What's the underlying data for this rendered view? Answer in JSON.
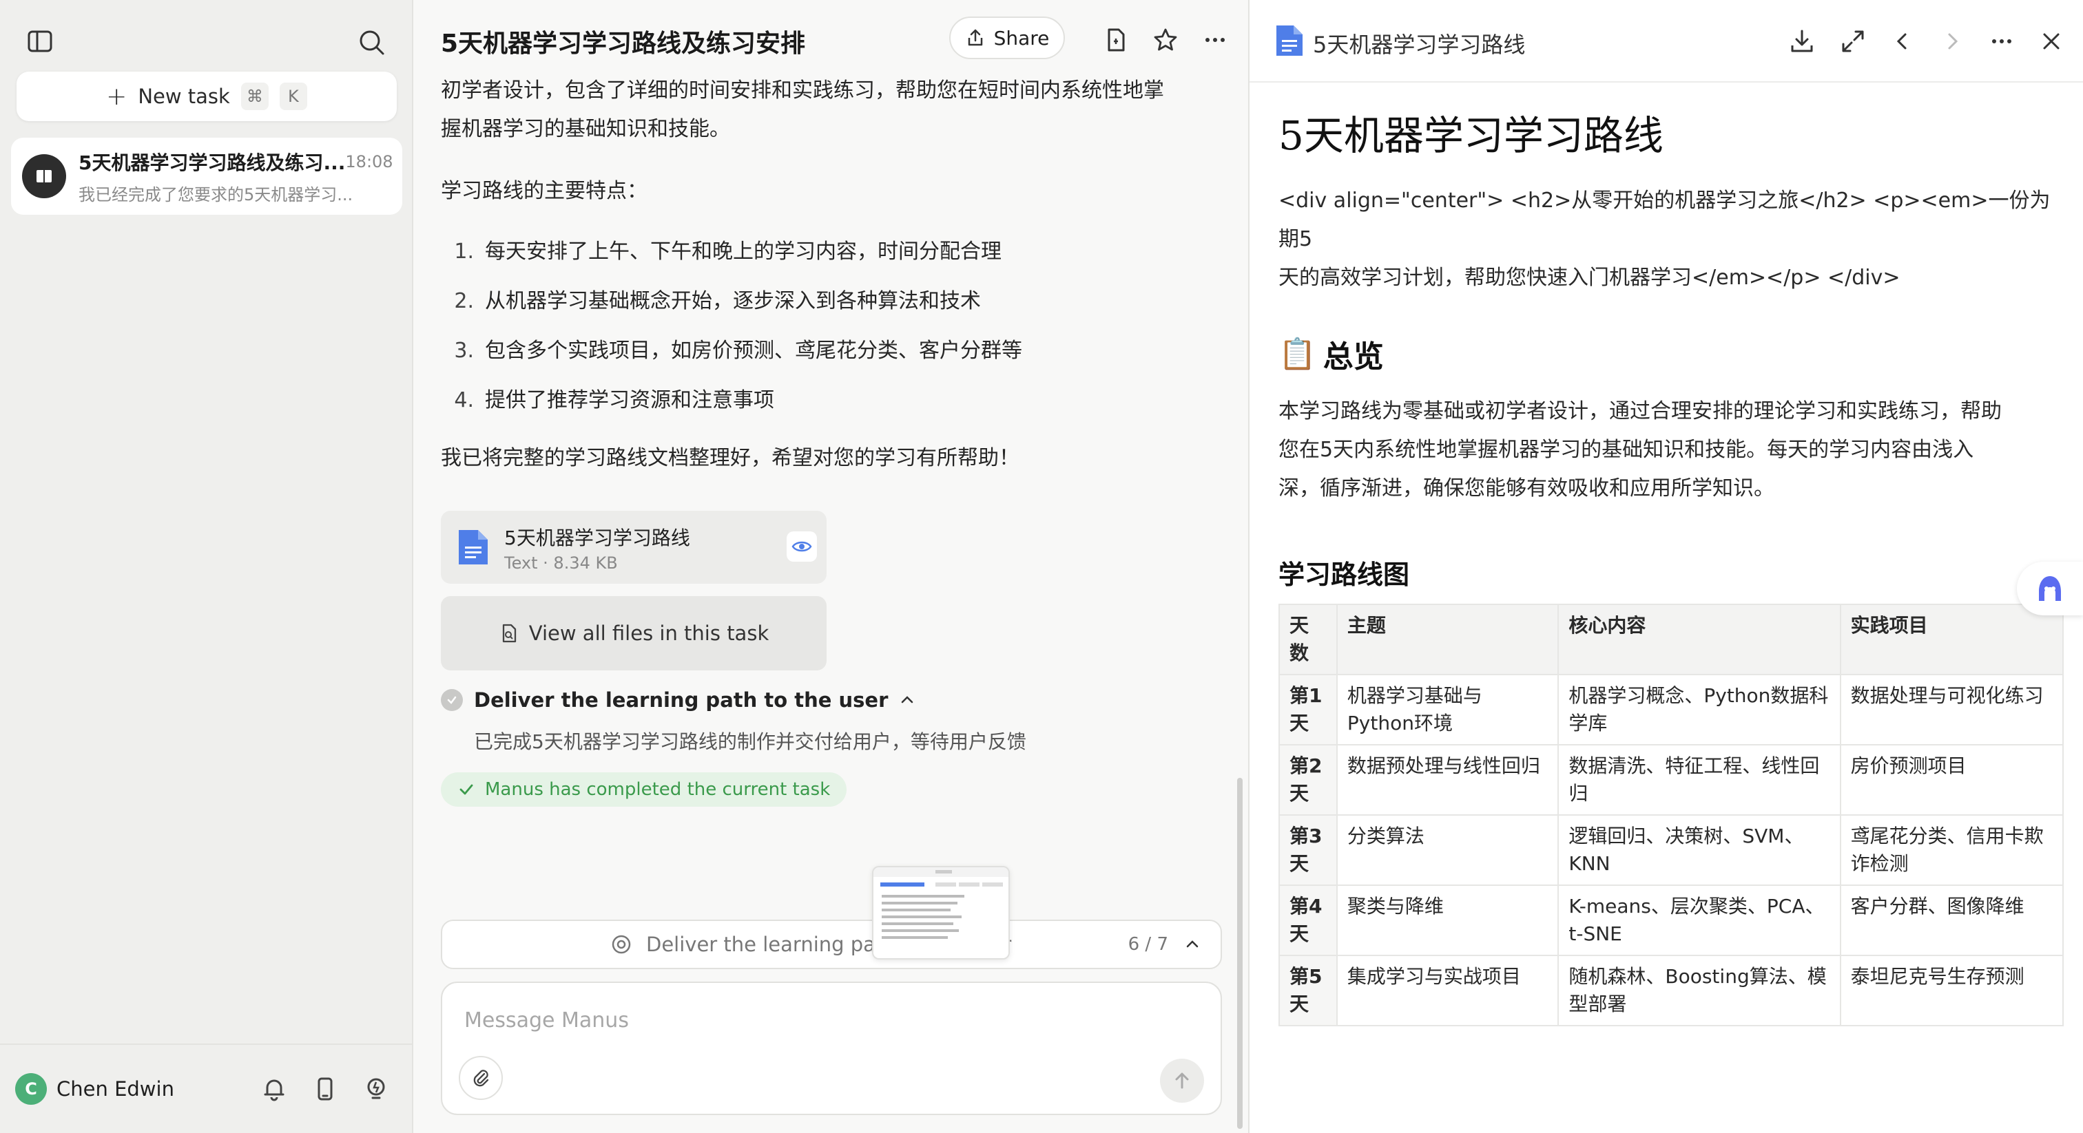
{
  "sidebar": {
    "new_task_label": "New task",
    "shortcut_cmd": "⌘",
    "shortcut_key": "K",
    "task": {
      "title": "5天机器学习学习路线及练习...",
      "time": "18:08",
      "preview": "我已经完成了您要求的5天机器学习..."
    },
    "user": {
      "initial": "C",
      "name": "Chen Edwin"
    }
  },
  "chat": {
    "title": "5天机器学习学习路线及练习安排",
    "share_label": "Share",
    "intro_line1": "初学者设计，包含了详细的时间安排和实践练习，帮助您在短时间内系统性地掌",
    "intro_line2": "握机器学习的基础知识和技能。",
    "features_heading": "学习路线的主要特点：",
    "features": [
      "每天安排了上午、下午和晚上的学习内容，时间分配合理",
      "从机器学习基础概念开始，逐步深入到各种算法和技术",
      "包含多个实践项目，如房价预测、鸢尾花分类、客户分群等",
      "提供了推荐学习资源和注意事项"
    ],
    "closing": "我已将完整的学习路线文档整理好，希望对您的学习有所帮助！",
    "file": {
      "name": "5天机器学习学习路线",
      "meta": "Text · 8.34 KB"
    },
    "view_all_label": "View all files in this task",
    "step": {
      "title": "Deliver the learning path to the user",
      "desc": "已完成5天机器学习学习路线的制作并交付给用户，等待用户反馈"
    },
    "completed_label": "Manus has completed the current task",
    "progress": {
      "label": "Deliver the learning path to the user",
      "count": "6 / 7"
    },
    "input_placeholder": "Message Manus"
  },
  "preview": {
    "file_title": "5天机器学习学习路线",
    "doc_title": "5天机器学习学习路线",
    "raw_html_line1": "<div align=\"center\"> <h2>从零开始的机器学习之旅</h2> <p><em>一份为期5",
    "raw_html_line2": "天的高效学习计划，帮助您快速入门机器学习</em></p> </div>",
    "overview_emoji": "📋",
    "overview_heading": "总览",
    "overview_line1": "本学习路线为零基础或初学者设计，通过合理安排的理论学习和实践练习，帮助",
    "overview_line2": "您在5天内系统性地掌握机器学习的基础知识和技能。每天的学习内容由浅入",
    "overview_line3": "深，循序渐进，确保您能够有效吸收和应用所学知识。",
    "roadmap_heading": "学习路线图",
    "table": {
      "headers": [
        "天数",
        "主题",
        "核心内容",
        "实践项目"
      ],
      "rows": [
        [
          "第1天",
          "机器学习基础与Python环境",
          "机器学习概念、Python数据科学库",
          "数据处理与可视化练习"
        ],
        [
          "第2天",
          "数据预处理与线性回归",
          "数据清洗、特征工程、线性回归",
          "房价预测项目"
        ],
        [
          "第3天",
          "分类算法",
          "逻辑回归、决策树、SVM、KNN",
          "鸢尾花分类、信用卡欺诈检测"
        ],
        [
          "第4天",
          "聚类与降维",
          "K-means、层次聚类、PCA、t-SNE",
          "客户分群、图像降维"
        ],
        [
          "第5天",
          "集成学习与实战项目",
          "随机森林、Boosting算法、模型部署",
          "泰坦尼克号生存预测"
        ]
      ]
    }
  },
  "colors": {
    "accent_green": "#3a9a4b",
    "doc_blue": "#4f7ee8"
  }
}
